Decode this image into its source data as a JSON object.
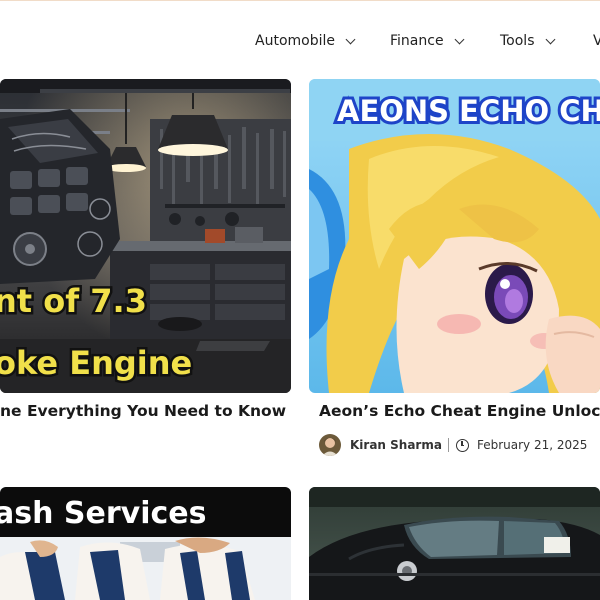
{
  "nav": {
    "items": [
      {
        "label": "Automobile"
      },
      {
        "label": "Finance"
      },
      {
        "label": "Tools"
      },
      {
        "label": "V"
      }
    ]
  },
  "cards": [
    {
      "overlay_line1": "nt of 7.3",
      "overlay_line2": "oke Engine",
      "title": "ne Everything You Need to Know"
    },
    {
      "overlay_banner": "AEONS ECHO CH",
      "title": "Aeon’s Echo Cheat Engine Unlocking",
      "author": "Kiran Sharma",
      "date": "February 21, 2025"
    },
    {
      "overlay_banner": "ash Services"
    },
    {}
  ],
  "colors": {
    "accent_yellow": "#f1e04a",
    "banner_blue": "#1e44c8",
    "sky_blue": "#8ed3f5"
  }
}
